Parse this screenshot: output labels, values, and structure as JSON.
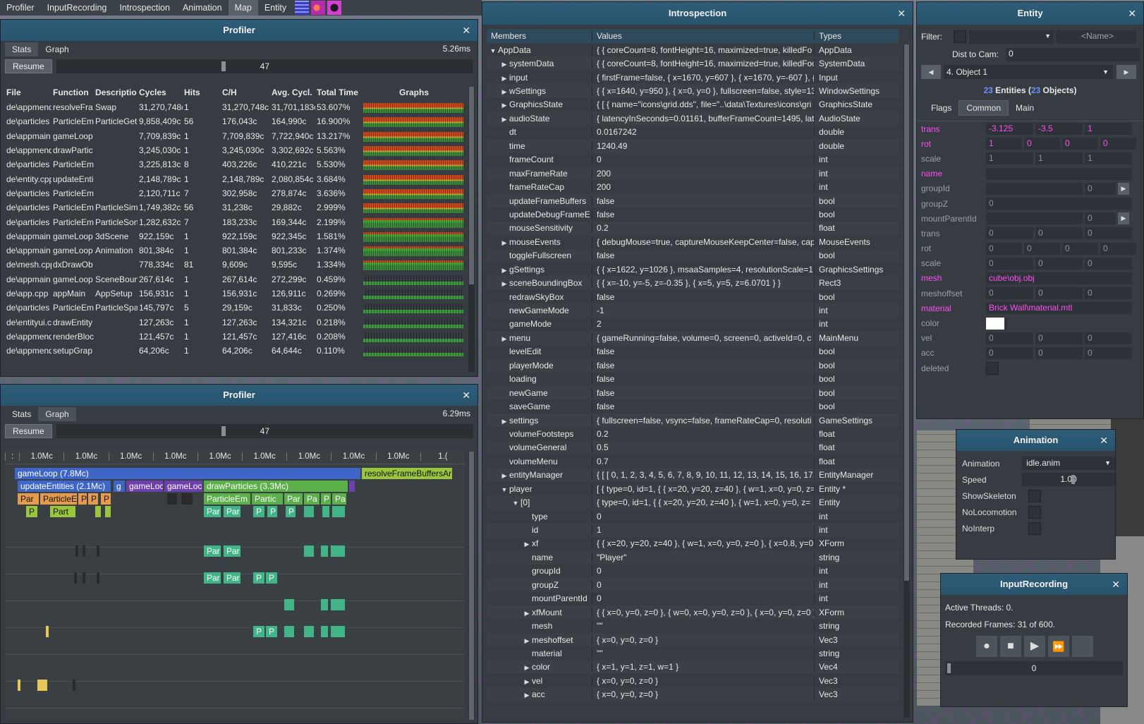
{
  "menu": [
    "Profiler",
    "InputRecording",
    "Introspection",
    "Animation",
    "Map",
    "Entity"
  ],
  "menu_active": "Map",
  "profiler_stats": {
    "title": "Profiler",
    "tabs": [
      "Stats",
      "Graph"
    ],
    "time": "5.26ms",
    "resume": "Resume",
    "slider_value": "47",
    "columns": [
      "File",
      "Function",
      "Descriptio",
      "Cycles",
      "Hits",
      "C/H",
      "Avg. Cycl.",
      "Total Time",
      "Graphs"
    ],
    "rows": [
      [
        "de\\appmend",
        "resolveFra",
        "Swap",
        "31,270,748c",
        "1",
        "31,270,748c",
        "31,701,183c",
        "53.607%"
      ],
      [
        "de\\particles",
        "ParticleEm",
        "ParticleGet",
        "9,858,409c",
        "56",
        "176,043c",
        "164,990c",
        "16.900%"
      ],
      [
        "de\\appmain",
        "gameLoop",
        "",
        "7,709,839c",
        "1",
        "7,709,839c",
        "7,722,940c",
        "13.217%"
      ],
      [
        "de\\appmend",
        "drawPartic",
        "",
        "3,245,030c",
        "1",
        "3,245,030c",
        "3,302,692c",
        "5.563%"
      ],
      [
        "de\\particles",
        "ParticleEm",
        "",
        "3,225,813c",
        "8",
        "403,226c",
        "410,221c",
        "5.530%"
      ],
      [
        "de\\entity.cpp",
        "updateEnti",
        "",
        "2,148,789c",
        "1",
        "2,148,789c",
        "2,080,854c",
        "3.684%"
      ],
      [
        "de\\particles",
        "ParticleEm",
        "",
        "2,120,711c",
        "7",
        "302,958c",
        "278,874c",
        "3.636%"
      ],
      [
        "de\\particles",
        "ParticleEm",
        "ParticleSim",
        "1,749,382c",
        "56",
        "31,238c",
        "29,882c",
        "2.999%"
      ],
      [
        "de\\particles",
        "ParticleEm",
        "ParticleSort",
        "1,282,632c",
        "7",
        "183,233c",
        "169,344c",
        "2.199%"
      ],
      [
        "de\\appmain",
        "gameLoop",
        "3dScene",
        "922,159c",
        "1",
        "922,159c",
        "922,345c",
        "1.581%"
      ],
      [
        "de\\appmain",
        "gameLoop",
        "Animation",
        "801,384c",
        "1",
        "801,384c",
        "801,233c",
        "1.374%"
      ],
      [
        "de\\mesh.cpp",
        "dxDrawOb",
        "",
        "778,334c",
        "81",
        "9,609c",
        "9,595c",
        "1.334%"
      ],
      [
        "de\\appmain",
        "gameLoop",
        "SceneBoun",
        "267,614c",
        "1",
        "267,614c",
        "272,299c",
        "0.459%"
      ],
      [
        "de\\app.cpp",
        "appMain",
        "AppSetup",
        "156,931c",
        "1",
        "156,931c",
        "126,911c",
        "0.269%"
      ],
      [
        "de\\particles",
        "ParticleEm",
        "ParticleSpa",
        "145,797c",
        "5",
        "29,159c",
        "31,833c",
        "0.250%"
      ],
      [
        "de\\entityui.c",
        "drawEntity",
        "",
        "127,263c",
        "1",
        "127,263c",
        "134,321c",
        "0.218%"
      ],
      [
        "de\\appmend",
        "renderBloc",
        "",
        "121,457c",
        "1",
        "121,457c",
        "127,416c",
        "0.208%"
      ],
      [
        "de\\appmend",
        "setupGrap",
        "",
        "64,206c",
        "1",
        "64,206c",
        "64,644c",
        "0.110%"
      ]
    ]
  },
  "profiler_graph": {
    "title": "Profiler",
    "tabs": [
      "Stats",
      "Graph"
    ],
    "time": "6.29ms",
    "resume": "Resume",
    "slider_value": "47",
    "ruler": [
      ":",
      "1.0Mc",
      "1.0Mc",
      "1.0Mc",
      "1.0Mc",
      "1.0Mc",
      "1.0Mc",
      "1.0Mc",
      "1.0Mc",
      "1.0Mc",
      "1.("
    ],
    "bars": {
      "gameloop": "gameLoop (7.8Mc)",
      "resolve": "resolveFrameBuffersAr",
      "update": "updateEntities (2.1Mc)",
      "g": "g",
      "gameloop2": "gameLoc",
      "gameloop3": "gameLoc",
      "drawparticles": "drawParticles (3.3Mc)",
      "par": "Par",
      "particlee": "ParticleE",
      "p": "P",
      "particleem": "ParticleEm",
      "partic": "Partic",
      "pa": "Pa",
      "part": "Part",
      "pc": "Pa"
    }
  },
  "introspection": {
    "title": "Introspection",
    "columns": [
      "Members",
      "Values",
      "Types"
    ],
    "rows": [
      {
        "d": 0,
        "a": "▼",
        "m": "AppData",
        "v": "{ { coreCount=8, fontHeight=16, maximized=true, killedFo",
        "t": "AppData"
      },
      {
        "d": 1,
        "a": "▶",
        "m": "systemData",
        "v": "{ { coreCount=8, fontHeight=16, maximized=true, killedFocu",
        "t": "SystemData"
      },
      {
        "d": 1,
        "a": "▶",
        "m": "input",
        "v": "{ firstFrame=false, { x=1670, y=607 }, { x=1670, y=-607 }, { x",
        "t": "Input"
      },
      {
        "d": 1,
        "a": "▶",
        "m": "wSettings",
        "v": "{ { x=1640, y=950 }, { x=0, y=0 }, fullscreen=false, style=13",
        "t": "WindowSettings"
      },
      {
        "d": 1,
        "a": "▶",
        "m": "GraphicsState",
        "v": "{ [ { name=\"icons\\grid.dds\", file=\"..\\data\\Textures\\icons\\gri",
        "t": "GraphicsState"
      },
      {
        "d": 1,
        "a": "▶",
        "m": "audioState",
        "v": "{ latencyInSeconds=0.01161, bufferFrameCount=1495, lat",
        "t": "AudioState"
      },
      {
        "d": 1,
        "a": "",
        "m": "dt",
        "v": "0.0167242",
        "t": "double"
      },
      {
        "d": 1,
        "a": "",
        "m": "time",
        "v": "1240.49",
        "t": "double"
      },
      {
        "d": 1,
        "a": "",
        "m": "frameCount",
        "v": "0",
        "t": "int"
      },
      {
        "d": 1,
        "a": "",
        "m": "maxFrameRate",
        "v": "200",
        "t": "int"
      },
      {
        "d": 1,
        "a": "",
        "m": "frameRateCap",
        "v": "200",
        "t": "int"
      },
      {
        "d": 1,
        "a": "",
        "m": "updateFrameBuffers",
        "v": "false",
        "t": "bool"
      },
      {
        "d": 1,
        "a": "",
        "m": "updateDebugFrameE",
        "v": "false",
        "t": "bool"
      },
      {
        "d": 1,
        "a": "",
        "m": "mouseSensitivity",
        "v": "0.2",
        "t": "float"
      },
      {
        "d": 1,
        "a": "▶",
        "m": "mouseEvents",
        "v": "{ debugMouse=true, captureMouseKeepCenter=false, cap",
        "t": "MouseEvents"
      },
      {
        "d": 1,
        "a": "",
        "m": "toggleFullscreen",
        "v": "false",
        "t": "bool"
      },
      {
        "d": 1,
        "a": "▶",
        "m": "gSettings",
        "v": "{ { x=1622, y=1026 }, msaaSamples=4, resolutionScale=1",
        "t": "GraphicsSettings"
      },
      {
        "d": 1,
        "a": "▶",
        "m": "sceneBoundingBox",
        "v": "{ { x=-10, y=-5, z=-0.35 }, { x=5, y=5, z=6.0701 } }",
        "t": "Rect3"
      },
      {
        "d": 1,
        "a": "",
        "m": "redrawSkyBox",
        "v": "false",
        "t": "bool"
      },
      {
        "d": 1,
        "a": "",
        "m": "newGameMode",
        "v": "-1",
        "t": "int"
      },
      {
        "d": 1,
        "a": "",
        "m": "gameMode",
        "v": "2",
        "t": "int"
      },
      {
        "d": 1,
        "a": "▶",
        "m": "menu",
        "v": "{ gameRunning=false, volume=0, screen=0, activeId=0, c",
        "t": "MainMenu"
      },
      {
        "d": 1,
        "a": "",
        "m": "levelEdit",
        "v": "false",
        "t": "bool"
      },
      {
        "d": 1,
        "a": "",
        "m": "playerMode",
        "v": "false",
        "t": "bool"
      },
      {
        "d": 1,
        "a": "",
        "m": "loading",
        "v": "false",
        "t": "bool"
      },
      {
        "d": 1,
        "a": "",
        "m": "newGame",
        "v": "false",
        "t": "bool"
      },
      {
        "d": 1,
        "a": "",
        "m": "saveGame",
        "v": "false",
        "t": "bool"
      },
      {
        "d": 1,
        "a": "▶",
        "m": "settings",
        "v": "{ fullscreen=false, vsync=false, frameRateCap=0, resoluti",
        "t": "GameSettings"
      },
      {
        "d": 1,
        "a": "",
        "m": "volumeFootsteps",
        "v": "0.2",
        "t": "float"
      },
      {
        "d": 1,
        "a": "",
        "m": "volumeGeneral",
        "v": "0.5",
        "t": "float"
      },
      {
        "d": 1,
        "a": "",
        "m": "volumeMenu",
        "v": "0.7",
        "t": "float"
      },
      {
        "d": 1,
        "a": "▶",
        "m": "entityManager",
        "v": "{ [ [ 0, 1, 2, 3, 4, 5, 6, 7, 8, 9, 10, 11, 12, 13, 14, 15, 16, 17, 18",
        "t": "EntityManager"
      },
      {
        "d": 1,
        "a": "▼",
        "m": "player",
        "v": "[ { type=0, id=1, { { x=20, y=20, z=40 }, { w=1, x=0, y=0, z=",
        "t": "Entity *"
      },
      {
        "d": 2,
        "a": "▼",
        "m": "[0]",
        "v": "{ type=0, id=1, { { x=20, y=20, z=40 }, { w=1, x=0, y=0, z=",
        "t": "Entity"
      },
      {
        "d": 3,
        "a": "",
        "m": "type",
        "v": "0",
        "t": "int"
      },
      {
        "d": 3,
        "a": "",
        "m": "id",
        "v": "1",
        "t": "int"
      },
      {
        "d": 3,
        "a": "▶",
        "m": "xf",
        "v": "{ { x=20, y=20, z=40 }, { w=1, x=0, y=0, z=0 }, { x=0.8, y=0.",
        "t": "XForm"
      },
      {
        "d": 3,
        "a": "",
        "m": "name",
        "v": "\"Player\"",
        "t": "string"
      },
      {
        "d": 3,
        "a": "",
        "m": "groupId",
        "v": "0",
        "t": "int"
      },
      {
        "d": 3,
        "a": "",
        "m": "groupZ",
        "v": "0",
        "t": "int"
      },
      {
        "d": 3,
        "a": "",
        "m": "mountParentId",
        "v": "0",
        "t": "int"
      },
      {
        "d": 3,
        "a": "▶",
        "m": "xfMount",
        "v": "{ { x=0, y=0, z=0 }, { w=0, x=0, y=0, z=0 }, { x=0, y=0, z=0 }",
        "t": "XForm"
      },
      {
        "d": 3,
        "a": "",
        "m": "mesh",
        "v": "\"\"",
        "t": "string"
      },
      {
        "d": 3,
        "a": "▶",
        "m": "meshoffset",
        "v": "{ x=0, y=0, z=0 }",
        "t": "Vec3"
      },
      {
        "d": 3,
        "a": "",
        "m": "material",
        "v": "\"\"",
        "t": "string"
      },
      {
        "d": 3,
        "a": "▶",
        "m": "color",
        "v": "{ x=1, y=1, z=1, w=1 }",
        "t": "Vec4"
      },
      {
        "d": 3,
        "a": "▶",
        "m": "vel",
        "v": "{ x=0, y=0, z=0 }",
        "t": "Vec3"
      },
      {
        "d": 3,
        "a": "▶",
        "m": "acc",
        "v": "{ x=0, y=0, z=0 }",
        "t": "Vec3"
      }
    ]
  },
  "entity": {
    "title": "Entity",
    "filter_label": "Filter:",
    "name_placeholder": "<Name>",
    "dist_label": "Dist to Cam:",
    "dist_value": "0",
    "selected_object": "4. Object 1",
    "count_a": "23",
    "count_text_1": " Entities (",
    "count_b": "23",
    "count_text_2": " Objects)",
    "tabs": [
      "Flags",
      "Common",
      "Main"
    ],
    "rows": [
      {
        "l": "trans",
        "pink": true,
        "f": [
          "-3.125",
          "-3.5",
          "1"
        ],
        "w": "w3",
        "fp": true
      },
      {
        "l": "rot",
        "pink": true,
        "f": [
          "1",
          "0",
          "0",
          "0"
        ],
        "w": "w4",
        "fp": true
      },
      {
        "l": "scale",
        "pink": false,
        "f": [
          "1",
          "1",
          "1"
        ],
        "w": "w3"
      },
      {
        "l": "name",
        "pink": true,
        "f": [
          ""
        ],
        "w": "wide"
      },
      {
        "l": "groupId",
        "pink": false,
        "f": [
          "",
          "0"
        ],
        "w": "grp",
        "btn": true
      },
      {
        "l": "groupZ",
        "pink": false,
        "f": [
          "0"
        ],
        "w": "wide"
      },
      {
        "l": "mountParentId",
        "pink": false,
        "f": [
          "",
          "0"
        ],
        "w": "grp",
        "btn": true
      },
      {
        "l": "trans",
        "pink": false,
        "f": [
          "0",
          "0",
          "0"
        ],
        "w": "w3"
      },
      {
        "l": "rot",
        "pink": false,
        "f": [
          "0",
          "0",
          "0",
          "0"
        ],
        "w": "w4"
      },
      {
        "l": "scale",
        "pink": false,
        "f": [
          "0",
          "0",
          "0"
        ],
        "w": "w3"
      },
      {
        "l": "mesh",
        "pink": true,
        "f": [
          "cube\\obj.obj"
        ],
        "w": "wide",
        "fp": true
      },
      {
        "l": "meshoffset",
        "pink": false,
        "f": [
          "0",
          "0",
          "0"
        ],
        "w": "w3"
      },
      {
        "l": "material",
        "pink": true,
        "f": [
          "Brick Wall\\material.mtl"
        ],
        "w": "wide",
        "fp": true
      },
      {
        "l": "color",
        "pink": false,
        "f": [],
        "w": "color"
      },
      {
        "l": "vel",
        "pink": false,
        "f": [
          "0",
          "0",
          "0"
        ],
        "w": "w3"
      },
      {
        "l": "acc",
        "pink": false,
        "f": [
          "0",
          "0",
          "0"
        ],
        "w": "w3"
      },
      {
        "l": "deleted",
        "pink": false,
        "f": [],
        "w": "check"
      }
    ]
  },
  "animation": {
    "title": "Animation",
    "anim_label": "Animation",
    "anim_value": "idle.anim",
    "speed_label": "Speed",
    "speed_value": "1.00",
    "show_skeleton": "ShowSkeleton",
    "no_locomotion": "NoLocomotion",
    "no_interp": "NoInterp"
  },
  "input_recording": {
    "title": "InputRecording",
    "threads": "Active Threads: 0.",
    "frames": "Recorded Frames: 31 of 600.",
    "slider_value": "0"
  },
  "colors": {
    "title_bar": "#2f5d78",
    "pink": "#ff4df0",
    "panel": "#363c42"
  }
}
